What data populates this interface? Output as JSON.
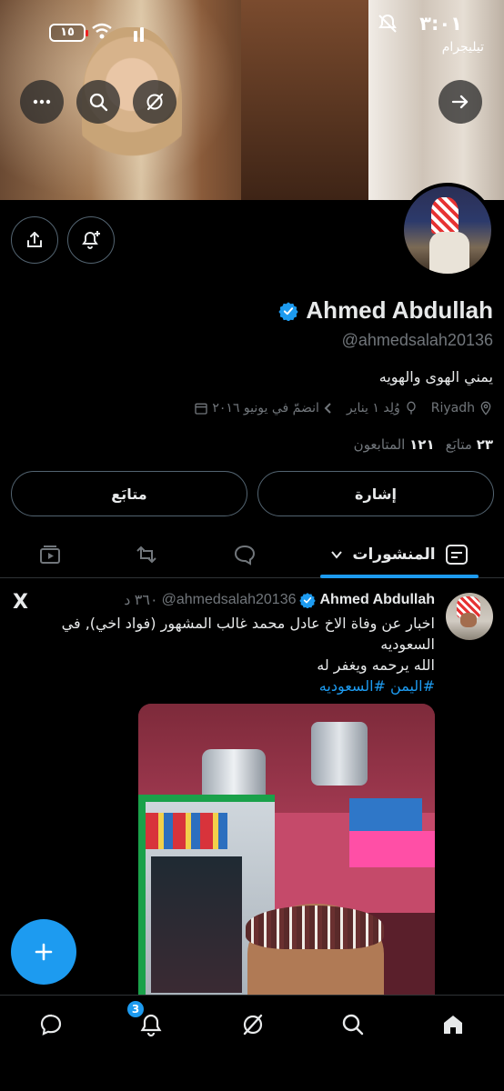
{
  "status_bar": {
    "time": "٣:٠١",
    "notification_source": "تيليجرام",
    "battery": "١٥"
  },
  "profile": {
    "name": "Ahmed Abdullah",
    "handle": "@ahmedsalah20136",
    "bio": "يمني الهوى والهويه",
    "location": "Riyadh",
    "birthday": "وُلِد ١ يناير",
    "joined": "انضمّ في يونيو ٢٠١٦",
    "following_count": "٢٣",
    "following_label": "متابَع",
    "followers_count": "١٢١",
    "followers_label": "المتابعون",
    "verified_color": "#1d9bf0"
  },
  "actions": {
    "mention_label": "إشارة",
    "follow_label": "متابَع"
  },
  "tabs": {
    "posts_label": "المنشورات"
  },
  "post": {
    "author_name": "Ahmed Abdullah",
    "author_handle": "@ahmedsalah20136",
    "time": "٣٦٠ د",
    "text_line1": "اخبار عن وفاة الاخ عادل محمد غالب المشهور (فواد اخي), في السعوديه",
    "text_line2": "الله يرحمه ويغفر له",
    "hashtags": "#اليمن #السعوديه",
    "source_icon": "X"
  },
  "bottom_nav": {
    "notifications_badge": "3"
  },
  "colors": {
    "accent": "#1d9bf0",
    "background": "#000000",
    "secondary_text": "#71767b"
  }
}
